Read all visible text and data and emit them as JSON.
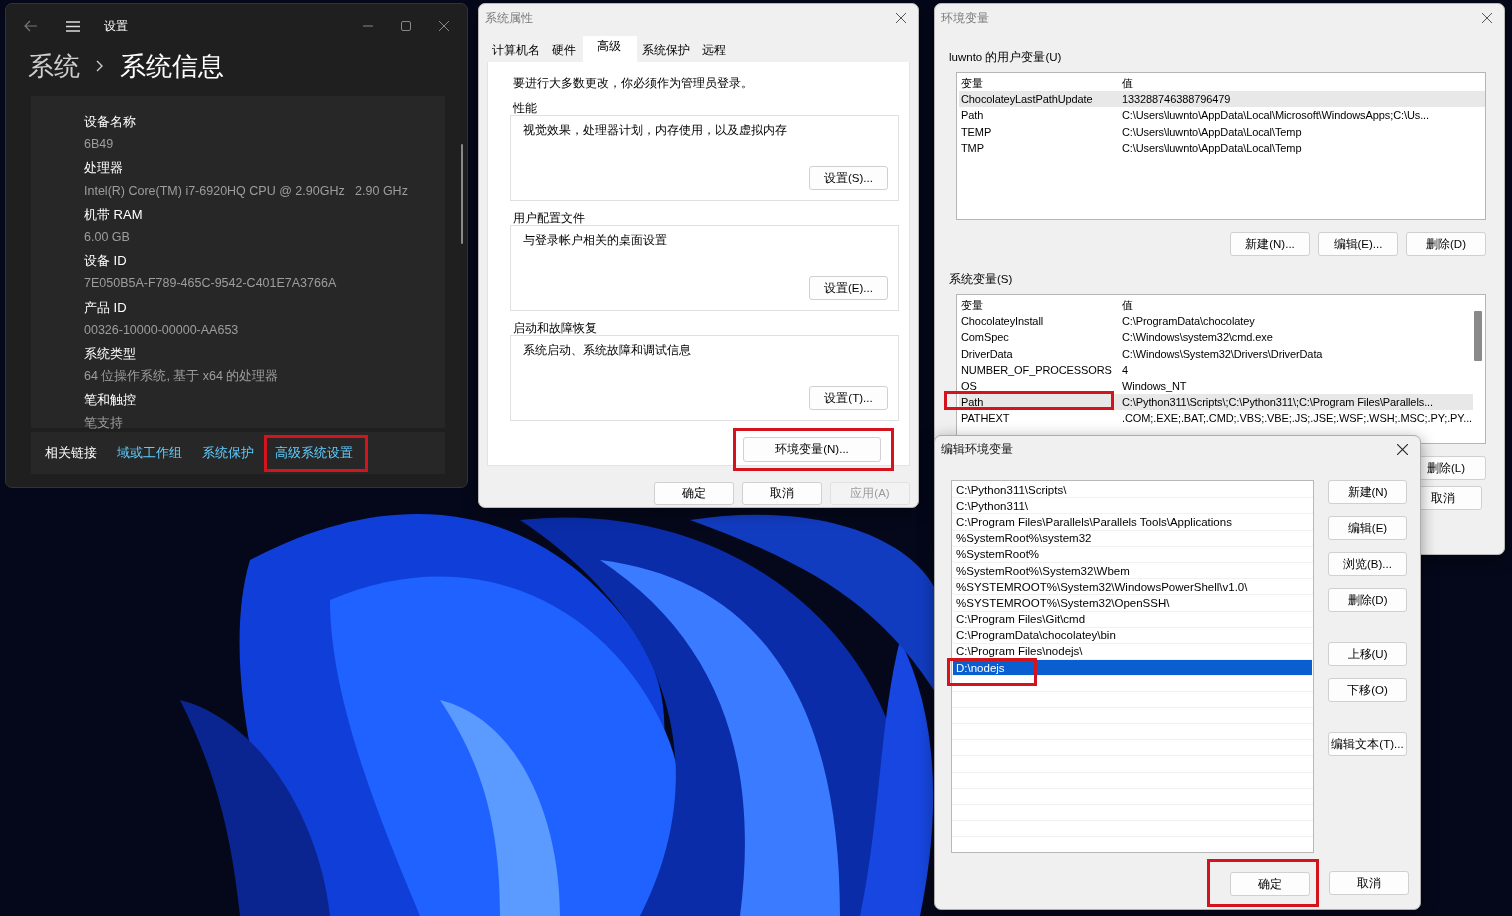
{
  "settings_window": {
    "title": "设置",
    "breadcrumb": [
      "系统",
      "系统信息"
    ],
    "specs": [
      {
        "label": "设备名称",
        "value": "6B49"
      },
      {
        "label": "处理器",
        "value": "Intel(R) Core(TM) i7-6920HQ CPU @ 2.90GHz   2.90 GHz"
      },
      {
        "label": "机带 RAM",
        "value": "6.00 GB"
      },
      {
        "label": "设备 ID",
        "value": "7E050B5A-F789-465C-9542-C401E7A3766A"
      },
      {
        "label": "产品 ID",
        "value": "00326-10000-00000-AA653"
      },
      {
        "label": "系统类型",
        "value": "64 位操作系统, 基于 x64 的处理器"
      },
      {
        "label": "笔和触控",
        "value": "笔支持"
      }
    ],
    "related_label": "相关链接",
    "links": [
      {
        "text": "域或工作组",
        "highlighted": false
      },
      {
        "text": "系统保护",
        "highlighted": false
      },
      {
        "text": "高级系统设置",
        "highlighted": true
      }
    ]
  },
  "system_properties": {
    "title": "系统属性",
    "tabs": [
      {
        "label": "计算机名",
        "selected": false
      },
      {
        "label": "硬件",
        "selected": false
      },
      {
        "label": "高级",
        "selected": true
      },
      {
        "label": "系统保护",
        "selected": false
      },
      {
        "label": "远程",
        "selected": false
      }
    ],
    "note": "要进行大多数更改，你必须作为管理员登录。",
    "groups": [
      {
        "title": "性能",
        "description": "视觉效果，处理器计划，内存使用，以及虚拟内存",
        "button": "设置(S)..."
      },
      {
        "title": "用户配置文件",
        "description": "与登录帐户相关的桌面设置",
        "button": "设置(E)..."
      },
      {
        "title": "启动和故障恢复",
        "description": "系统启动、系统故障和调试信息",
        "button": "设置(T)..."
      }
    ],
    "env_button": {
      "label": "环境变量(N)...",
      "highlighted": true
    },
    "buttons": [
      {
        "label": "确定",
        "disabled": false
      },
      {
        "label": "取消",
        "disabled": false
      },
      {
        "label": "应用(A)",
        "disabled": true
      }
    ]
  },
  "environment_variables": {
    "title": "环境变量",
    "user_vars": {
      "title": "luwnto 的用户变量(U)",
      "columns": [
        "变量",
        "值"
      ],
      "rows": [
        {
          "name": "ChocolateyLastPathUpdate",
          "value": "133288746388796479",
          "selected": true,
          "highlighted": false
        },
        {
          "name": "Path",
          "value": "C:\\Users\\luwnto\\AppData\\Local\\Microsoft\\WindowsApps;C:\\Us...",
          "selected": false,
          "highlighted": false
        },
        {
          "name": "TEMP",
          "value": "C:\\Users\\luwnto\\AppData\\Local\\Temp",
          "selected": false,
          "highlighted": false
        },
        {
          "name": "TMP",
          "value": "C:\\Users\\luwnto\\AppData\\Local\\Temp",
          "selected": false,
          "highlighted": false
        }
      ],
      "buttons": [
        "新建(N)...",
        "编辑(E)...",
        "删除(D)"
      ]
    },
    "system_vars": {
      "title": "系统变量(S)",
      "columns": [
        "变量",
        "值"
      ],
      "rows": [
        {
          "name": "ChocolateyInstall",
          "value": "C:\\ProgramData\\chocolatey",
          "selected": false,
          "highlighted": false
        },
        {
          "name": "ComSpec",
          "value": "C:\\Windows\\system32\\cmd.exe",
          "selected": false,
          "highlighted": false
        },
        {
          "name": "DriverData",
          "value": "C:\\Windows\\System32\\Drivers\\DriverData",
          "selected": false,
          "highlighted": false
        },
        {
          "name": "NUMBER_OF_PROCESSORS",
          "value": "4",
          "selected": false,
          "highlighted": false
        },
        {
          "name": "OS",
          "value": "Windows_NT",
          "selected": false,
          "highlighted": false
        },
        {
          "name": "Path",
          "value": "C:\\Python311\\Scripts\\;C:\\Python311\\;C:\\Program Files\\Parallels...",
          "selected": true,
          "highlighted": true
        },
        {
          "name": "PATHEXT",
          "value": ".COM;.EXE;.BAT;.CMD;.VBS;.VBE;.JS;.JSE;.WSF;.WSH;.MSC;.PY;.PY...",
          "selected": false,
          "highlighted": false
        }
      ],
      "buttons": [
        "删除(L)"
      ]
    },
    "buttons": [
      "取消"
    ]
  },
  "edit_dialog": {
    "title": "编辑环境变量",
    "items": [
      {
        "text": "C:\\Python311\\Scripts\\",
        "selected": false,
        "highlighted": false
      },
      {
        "text": "C:\\Python311\\",
        "selected": false,
        "highlighted": false
      },
      {
        "text": "C:\\Program Files\\Parallels\\Parallels Tools\\Applications",
        "selected": false,
        "highlighted": false
      },
      {
        "text": "%SystemRoot%\\system32",
        "selected": false,
        "highlighted": false
      },
      {
        "text": "%SystemRoot%",
        "selected": false,
        "highlighted": false
      },
      {
        "text": "%SystemRoot%\\System32\\Wbem",
        "selected": false,
        "highlighted": false
      },
      {
        "text": "%SYSTEMROOT%\\System32\\WindowsPowerShell\\v1.0\\",
        "selected": false,
        "highlighted": false
      },
      {
        "text": "%SYSTEMROOT%\\System32\\OpenSSH\\",
        "selected": false,
        "highlighted": false
      },
      {
        "text": "C:\\Program Files\\Git\\cmd",
        "selected": false,
        "highlighted": false
      },
      {
        "text": "C:\\ProgramData\\chocolatey\\bin",
        "selected": false,
        "highlighted": false
      },
      {
        "text": "C:\\Program Files\\nodejs\\",
        "selected": false,
        "highlighted": false
      },
      {
        "text": "D:\\nodejs",
        "selected": true,
        "highlighted": true
      }
    ],
    "button_groups": [
      [
        "新建(N)",
        "编辑(E)",
        "浏览(B)...",
        "删除(D)"
      ],
      [
        "上移(U)",
        "下移(O)"
      ],
      [
        "编辑文本(T)..."
      ]
    ],
    "footer": [
      {
        "label": "确定",
        "highlighted": true
      },
      {
        "label": "取消",
        "highlighted": false
      }
    ]
  }
}
